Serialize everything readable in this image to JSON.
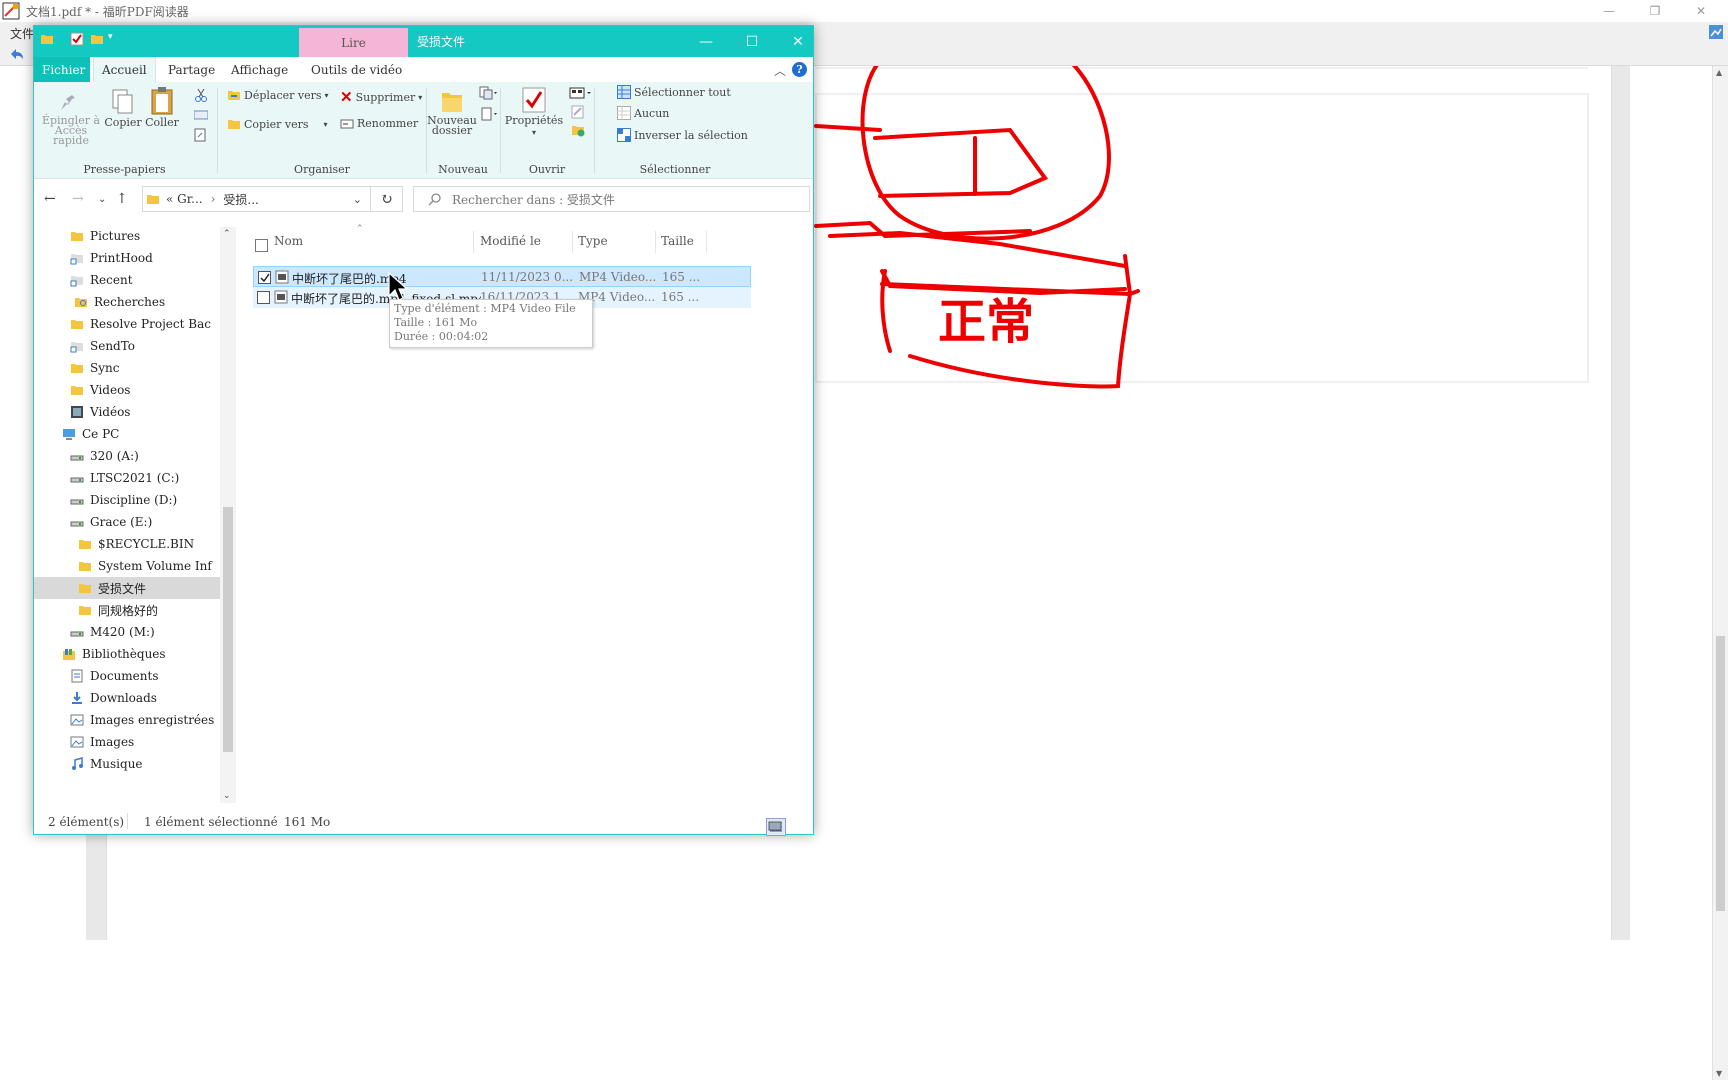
{
  "bg_app": {
    "title": "文档1.pdf * - 福昕PDF阅读器",
    "menu_item": "文件",
    "drawing_text": "正常"
  },
  "explorer": {
    "context_tab": "Lire",
    "window_title": "受损文件",
    "tabs": [
      "Fichier",
      "Accueil",
      "Partage",
      "Affichage",
      "Outils de vidéo"
    ],
    "ribbon": {
      "pin": "Épingler à\nAccès rapide",
      "copy": "Copier",
      "paste": "Coller",
      "move_to": "Déplacer vers",
      "copy_to": "Copier vers",
      "delete": "Supprimer",
      "rename": "Renommer",
      "new_folder": "Nouveau\ndossier",
      "properties": "Propriétés",
      "select_all": "Sélectionner tout",
      "select_none": "Aucun",
      "invert_selection": "Inverser la sélection",
      "groups": [
        "Presse-papiers",
        "Organiser",
        "Nouveau",
        "Ouvrir",
        "Sélectionner"
      ]
    },
    "address": {
      "crumb1": "« Gr...",
      "crumb2": "受损...",
      "search_placeholder": "Rechercher dans : 受损文件"
    },
    "tree": [
      {
        "label": "Pictures",
        "icon": "folder-icon"
      },
      {
        "label": "PrintHood",
        "icon": "shortcut-icon"
      },
      {
        "label": "Recent",
        "icon": "shortcut-icon"
      },
      {
        "label": "Recherches",
        "icon": "search-folder-icon"
      },
      {
        "label": "Resolve Project Bac",
        "icon": "folder-icon"
      },
      {
        "label": "SendTo",
        "icon": "shortcut-icon"
      },
      {
        "label": "Sync",
        "icon": "folder-icon"
      },
      {
        "label": "Videos",
        "icon": "folder-icon"
      },
      {
        "label": "Vidéos",
        "icon": "video-folder-icon"
      },
      {
        "label": "Ce PC",
        "icon": "computer-icon"
      },
      {
        "label": "320 (A:)",
        "icon": "drive-icon"
      },
      {
        "label": "LTSC2021 (C:)",
        "icon": "drive-icon"
      },
      {
        "label": "Discipline (D:)",
        "icon": "drive-icon"
      },
      {
        "label": "Grace (E:)",
        "icon": "drive-icon"
      },
      {
        "label": "$RECYCLE.BIN",
        "icon": "folder-icon"
      },
      {
        "label": "System Volume Inf",
        "icon": "folder-icon"
      },
      {
        "label": "受损文件",
        "icon": "folder-icon"
      },
      {
        "label": "同规格好的",
        "icon": "folder-icon"
      },
      {
        "label": "M420 (M:)",
        "icon": "drive-icon"
      },
      {
        "label": "Bibliothèques",
        "icon": "library-icon"
      },
      {
        "label": "Documents",
        "icon": "documents-icon"
      },
      {
        "label": "Downloads",
        "icon": "downloads-icon"
      },
      {
        "label": "Images enregistrées",
        "icon": "pictures-icon"
      },
      {
        "label": "Images",
        "icon": "pictures-icon"
      },
      {
        "label": "Musique",
        "icon": "music-icon"
      }
    ],
    "columns": [
      "Nom",
      "Modifié le",
      "Type",
      "Taille"
    ],
    "files": [
      {
        "name": "中断坏了尾巴的.mp4",
        "modified": "11/11/2023 0...",
        "type": "MP4 Video...",
        "size": "165 ...",
        "checked": true
      },
      {
        "name": "中断坏了尾巴的.mp4_fixed-sl.mp4",
        "modified": "16/11/2023 1...",
        "type": "MP4 Video...",
        "size": "165 ...",
        "checked": false
      }
    ],
    "tooltip": {
      "line1": "Type d'élément : MP4 Video File",
      "line2": "Taille : 161 Mo",
      "line3": "Durée : 00:04:02"
    },
    "status": {
      "count": "2 élément(s)",
      "selection": "1 élément sélectionné",
      "size": "161 Mo"
    }
  }
}
